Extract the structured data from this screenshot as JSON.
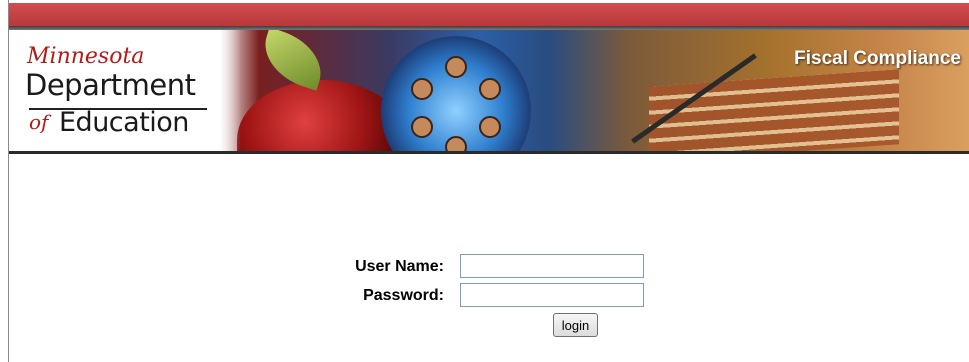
{
  "banner": {
    "logo_script": "Minnesota",
    "logo_department": "Department",
    "logo_of": "of",
    "logo_education": "Education",
    "title": "Fiscal Compliance"
  },
  "login": {
    "username_label": "User Name:",
    "username_value": "",
    "password_label": "Password:",
    "password_value": "",
    "submit_label": "login"
  },
  "colors": {
    "top_bar": "#c0393c",
    "brand_red": "#b31b1b"
  }
}
